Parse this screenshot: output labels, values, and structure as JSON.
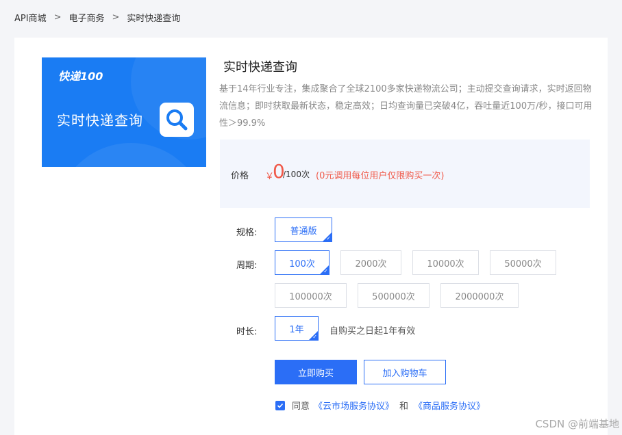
{
  "breadcrumb": {
    "items": [
      "API商城",
      "电子商务",
      "实时快递查询"
    ],
    "separator": ">"
  },
  "product": {
    "brand": "快递100",
    "image_title": "实时快递查询",
    "title": "实时快递查询",
    "description": "基于14年行业专注，集成聚合了全球2100多家快递物流公司；主动提交查询请求，实时返回物流信息；即时获取最新状态，稳定高效；日均查询量已突破4亿，吞吐量近100万/秒，接口可用性＞99.9%"
  },
  "price": {
    "label": "价格",
    "currency": "￥",
    "value": "0",
    "unit": "/100次",
    "note": "(0元调用每位用户仅限购买一次)"
  },
  "spec": {
    "label": "规格:",
    "options": [
      "普通版"
    ],
    "selected": "普通版"
  },
  "period": {
    "label": "周期:",
    "options": [
      "100次",
      "2000次",
      "10000次",
      "50000次",
      "100000次",
      "500000次",
      "2000000次"
    ],
    "selected": "100次"
  },
  "duration": {
    "label": "时长:",
    "options": [
      "1年"
    ],
    "selected": "1年",
    "note": "自购买之日起1年有效"
  },
  "actions": {
    "buy_label": "立即购买",
    "cart_label": "加入购物车"
  },
  "agreement": {
    "prefix": "同意",
    "link1": "《云市场服务协议》",
    "and": "和",
    "link2": "《商品服务协议》",
    "checked": true
  },
  "watermark": "CSDN @前端基地",
  "colors": {
    "primary": "#2b6ef6",
    "price": "#f05a4a",
    "banner": "#1a7cf3"
  }
}
